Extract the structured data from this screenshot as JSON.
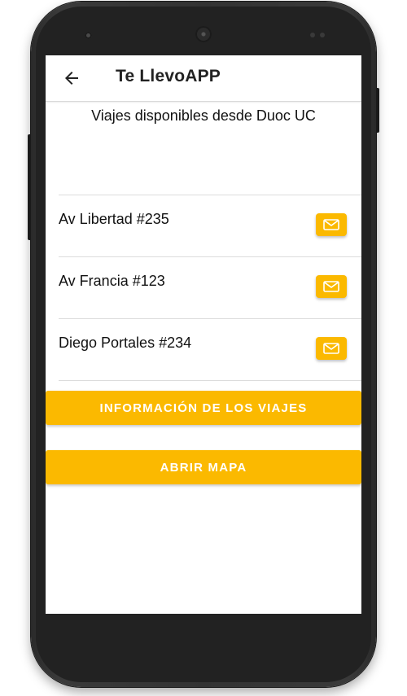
{
  "app": {
    "title": "Te LlevoAPP"
  },
  "header": {
    "back_icon": "arrow-left-icon"
  },
  "main": {
    "subtitle": "Viajes disponibles desde Duoc UC",
    "trips": [
      {
        "address": "Av Libertad #235",
        "action_icon": "mail-icon"
      },
      {
        "address": "Av Francia #123",
        "action_icon": "mail-icon"
      },
      {
        "address": "Diego Portales #234",
        "action_icon": "mail-icon"
      }
    ],
    "info_button": "INFORMACIÓN DE LOS VIAJES",
    "map_button": "ABRIR MAPA"
  },
  "colors": {
    "accent": "#fbb900",
    "text": "#111111",
    "background": "#ffffff"
  }
}
